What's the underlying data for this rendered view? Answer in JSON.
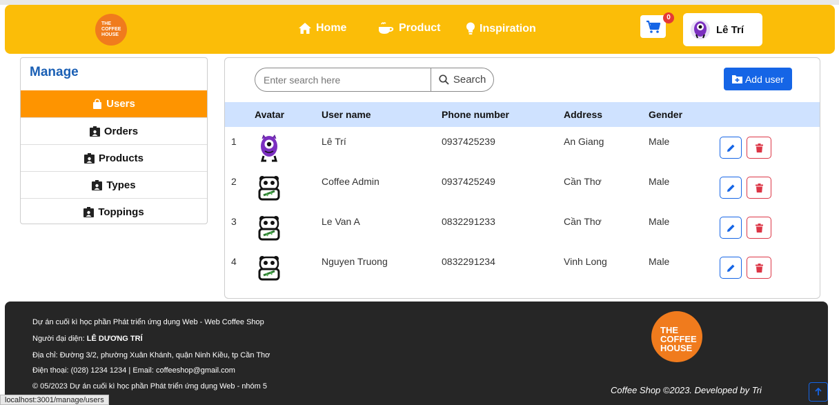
{
  "header": {
    "logo_text": "THE COFFEE HOUSE",
    "nav": {
      "home": "Home",
      "product": "Product",
      "inspiration": "Inspiration"
    },
    "cart_count": "0",
    "user_name": "Lê Trí"
  },
  "sidebar": {
    "title": "Manage",
    "items": [
      {
        "label": "Users",
        "active": true
      },
      {
        "label": "Orders",
        "active": false
      },
      {
        "label": "Products",
        "active": false
      },
      {
        "label": "Types",
        "active": false
      },
      {
        "label": "Toppings",
        "active": false
      }
    ]
  },
  "search": {
    "placeholder": "Enter search here",
    "button": "Search"
  },
  "add_user_label": "Add user",
  "table": {
    "headers": [
      "Avatar",
      "User name",
      "Phone number",
      "Address",
      "Gender"
    ],
    "rows": [
      {
        "index": "1",
        "avatar": "purple-monster-avatar",
        "name": "Lê Trí",
        "phone": "0937425239",
        "address": "An Giang",
        "gender": "Male"
      },
      {
        "index": "2",
        "avatar": "panda-avatar",
        "name": "Coffee Admin",
        "phone": "0937425249",
        "address": "Cần Thơ",
        "gender": "Male"
      },
      {
        "index": "3",
        "avatar": "panda-avatar",
        "name": "Le Van A",
        "phone": "0832291233",
        "address": "Cần Thơ",
        "gender": "Male"
      },
      {
        "index": "4",
        "avatar": "panda-avatar",
        "name": "Nguyen Truong",
        "phone": "0832291234",
        "address": "Vinh Long",
        "gender": "Male"
      }
    ]
  },
  "footer": {
    "line1": "Dự án cuối kì học phần Phát triển ứng dụng Web - Web Coffee Shop",
    "rep_label": "Người đại diện: ",
    "rep_name": "LÊ DƯƠNG TRÍ",
    "address": "Địa chỉ: Đường 3/2, phường Xuân Khánh, quận Ninh Kiều, tp Cần Thơ",
    "contact": "Điện thoại: (028) 1234 1234 | Email: coffeeshop@gmail.com",
    "copyright": "© 05/2023 Dự án cuối kì học phần Phát triển ứng dụng Web - nhóm 5",
    "logo_text": "THE COFFEE HOUSE",
    "credit": "Coffee Shop ©2023. Developed by Tri"
  },
  "status_url": "localhost:3001/manage/users",
  "colors": {
    "header": "#fbbd08",
    "active": "#fe9400",
    "primary": "#1565e6",
    "danger": "#dc3545",
    "footer": "#262626"
  }
}
